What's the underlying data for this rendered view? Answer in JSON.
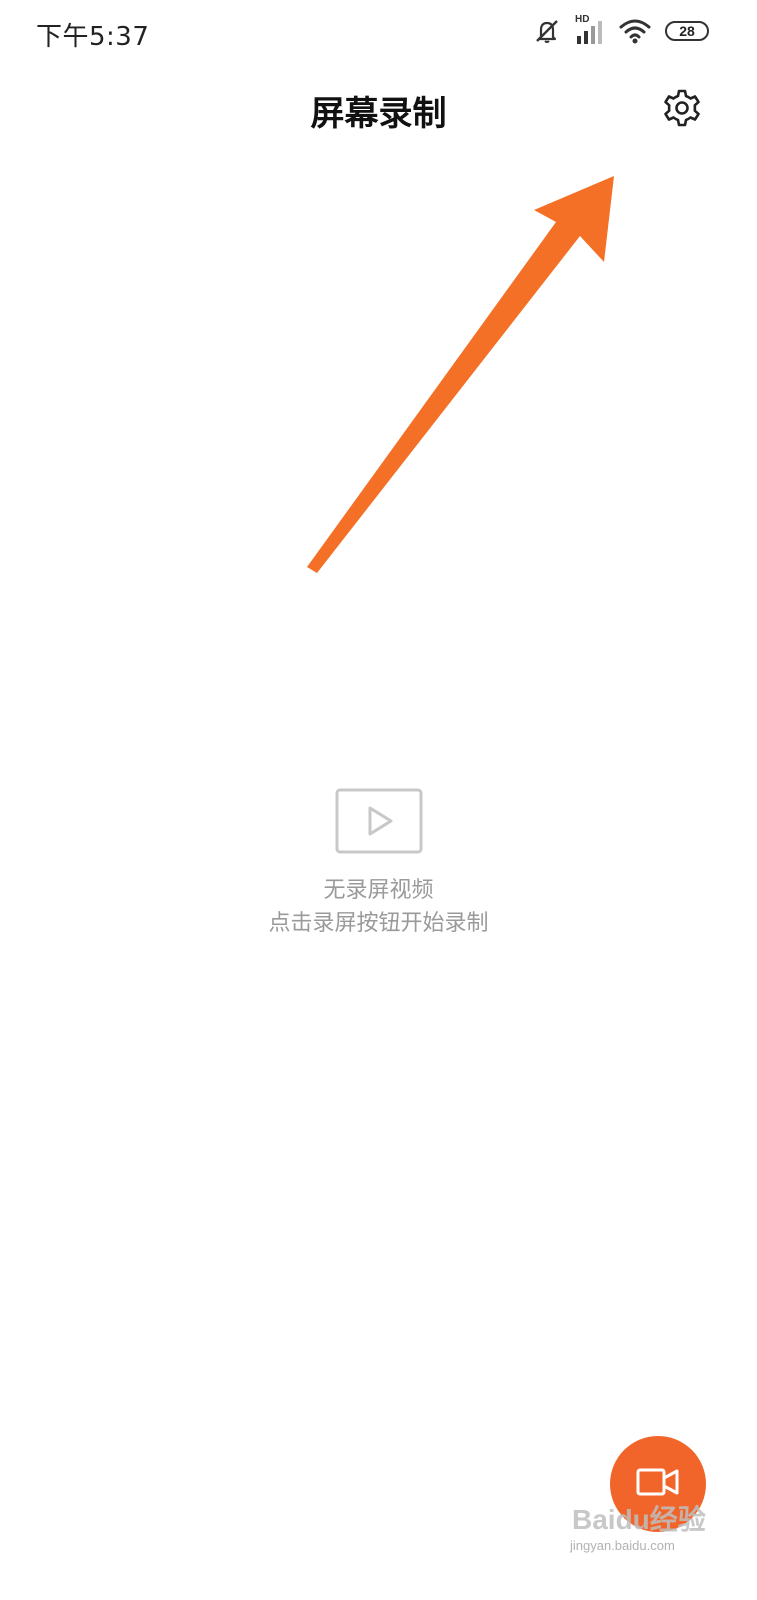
{
  "status_bar": {
    "time": "下午5:37",
    "network_label": "HD",
    "battery_level": "28",
    "icons": [
      "mute-icon",
      "signal-icon",
      "wifi-icon",
      "battery-icon"
    ]
  },
  "header": {
    "title": "屏幕录制",
    "settings_icon": "gear-icon"
  },
  "annotation": {
    "color": "#f47027",
    "points_to": "settings-button"
  },
  "empty_state": {
    "icon": "video-play-icon",
    "title": "无录屏视频",
    "hint": "点击录屏按钮开始录制"
  },
  "fab": {
    "icon": "video-camera-icon",
    "color": "#f2652a"
  },
  "watermark": {
    "main": "Baidu经验",
    "sub": "jingyan.baidu.com"
  }
}
